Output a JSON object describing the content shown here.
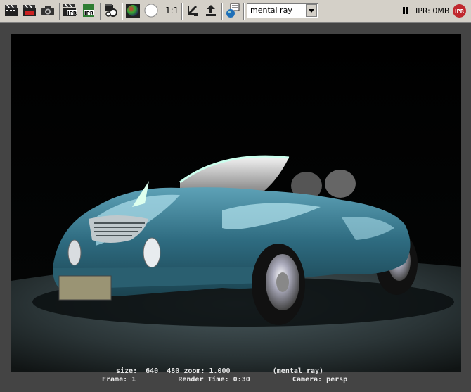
{
  "toolbar": {
    "buttons": [
      {
        "name": "redo-render-icon"
      },
      {
        "name": "render-region-icon"
      },
      {
        "name": "snapshot-icon"
      },
      {
        "name": "ipr-render-icon"
      },
      {
        "name": "refresh-ipr-icon"
      },
      {
        "name": "render-settings-icon"
      },
      {
        "name": "rgb-channel-icon"
      },
      {
        "name": "alpha-channel-icon"
      },
      {
        "name": "keep-image-icon"
      },
      {
        "name": "remove-image-icon"
      },
      {
        "name": "render-diagnostics-icon"
      }
    ],
    "ratio_label": "1:1",
    "renderer_select": {
      "value": "mental ray"
    },
    "ipr_label": "IPR: 0MB",
    "stop_label": "IPR"
  },
  "render_info": {
    "line1": "size:  640  480 zoom: 1.000          (mental ray)",
    "line2": "Frame: 1          Render Time: 0:30          Camera: persp"
  },
  "colors": {
    "toolbar_bg": "#d4d0c8",
    "viewport_bg": "#444444",
    "car_body": "#2e6b80",
    "ground": "#2a3436"
  }
}
